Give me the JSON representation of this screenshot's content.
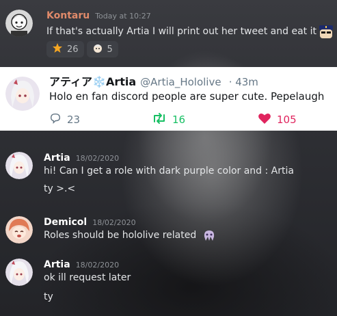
{
  "messages": {
    "kontaru": {
      "author": "Kontaru",
      "timestamp": "Today at 10:27",
      "text": "If that's actually Artia I will print out her tweet and eat it",
      "reactions": [
        {
          "icon": "star-icon",
          "count": "26"
        },
        {
          "icon": "custom-emote-icon",
          "count": "5"
        }
      ]
    },
    "artia_1": {
      "author": "Artia",
      "timestamp": "18/02/2020",
      "lines": [
        "hi! Can I get a role with dark purple color and : Artia",
        "ty >.<"
      ]
    },
    "demicol": {
      "author": "Demicol",
      "timestamp": "18/02/2020",
      "text": "Roles should be hololive related"
    },
    "artia_2": {
      "author": "Artia",
      "timestamp": "18/02/2020",
      "lines": [
        "ok ill request later",
        "ty"
      ]
    }
  },
  "tweet": {
    "display_name": "アティア❄️Artia",
    "handle": "@Artia_Hololive",
    "age": "· 43m",
    "text": "Holo en fan discord people are super cute. Pepelaugh",
    "replies": "23",
    "retweets": "16",
    "likes": "105"
  },
  "colors": {
    "kontaru_name": "#e08a6a",
    "retweet_green": "#17bf63",
    "like_red": "#e0245e"
  }
}
